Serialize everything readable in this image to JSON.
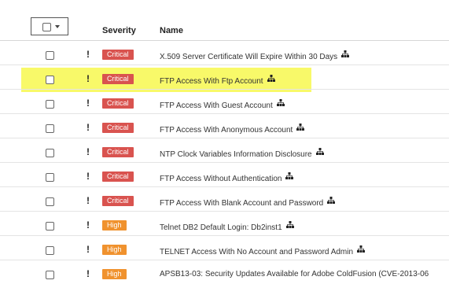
{
  "header": {
    "severity_label": "Severity",
    "name_label": "Name"
  },
  "icons": {
    "select_all_checkbox": "checkbox-icon",
    "select_all_dropdown": "chevron-down-icon",
    "severity_flag": "exclamation-icon",
    "name_suffix": "sitemap-icon"
  },
  "colors": {
    "critical": "#d9534f",
    "high": "#f0922e",
    "highlight": "#f7f84f"
  },
  "rows": [
    {
      "marker": "!",
      "severity": "Critical",
      "name": "X.509 Server Certificate Will Expire Within 30 Days"
    },
    {
      "marker": "!",
      "severity": "Critical",
      "name": "FTP Access With Ftp Account"
    },
    {
      "marker": "!",
      "severity": "Critical",
      "name": "FTP Access With Guest Account"
    },
    {
      "marker": "!",
      "severity": "Critical",
      "name": "FTP Access With Anonymous Account"
    },
    {
      "marker": "!",
      "severity": "Critical",
      "name": "NTP Clock Variables Information Disclosure"
    },
    {
      "marker": "!",
      "severity": "Critical",
      "name": "FTP Access Without Authentication"
    },
    {
      "marker": "!",
      "severity": "Critical",
      "name": "FTP Access With Blank Account and Password"
    },
    {
      "marker": "!",
      "severity": "High",
      "name": "Telnet DB2 Default Login: Db2inst1"
    },
    {
      "marker": "!",
      "severity": "High",
      "name": "TELNET Access With No Account and Password Admin"
    },
    {
      "marker": "!",
      "severity": "High",
      "name": "APSB13-03: Security Updates Available for Adobe ColdFusion (CVE-2013-06"
    }
  ]
}
